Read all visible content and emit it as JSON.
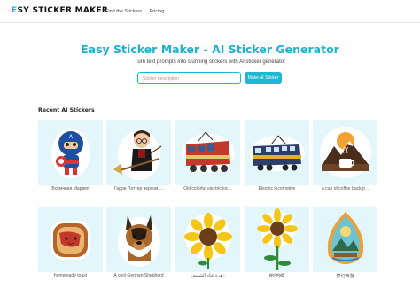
{
  "header": {
    "logo_prefix": "E",
    "logo_rest": "SY STICKER MAKER",
    "nav": [
      "Find the Stickers",
      "Pricing"
    ]
  },
  "hero": {
    "title": "Easy Sticker Maker - AI Sticker Generator",
    "subtitle": "Turn text prompts into stunning stickers with AI sticker generator",
    "search_placeholder": "Sticker description",
    "make_button": "Make AI Sticker"
  },
  "gallery": {
    "heading": "Recent AI Stickers",
    "items": [
      {
        "caption": "Всемчная Марвел",
        "icon": "captain-america-sticker"
      },
      {
        "caption": "Гарри Поттер верхом ...",
        "icon": "harry-potter-broom-sticker"
      },
      {
        "caption": "Old colorful electric loc...",
        "icon": "old-electric-locomotive-sticker"
      },
      {
        "caption": "Electric locomotive",
        "icon": "electric-locomotive-sticker"
      },
      {
        "caption": "a cup of coffee backgr...",
        "icon": "coffee-mountains-sticker"
      },
      {
        "caption": "homemade toast",
        "icon": "toast-sticker"
      },
      {
        "caption": "A cool German Shepherd",
        "icon": "german-shepherd-sticker"
      },
      {
        "caption": "زهرة عباد الشمس",
        "icon": "sunflower-sticker"
      },
      {
        "caption": "सूरजमुखी",
        "icon": "sunflower-tall-sticker"
      },
      {
        "caption": "梦幻西游",
        "icon": "fantasy-landscape-sticker"
      }
    ]
  },
  "colors": {
    "accent": "#1fb8d3",
    "card_bg": "#e3f6fb"
  }
}
